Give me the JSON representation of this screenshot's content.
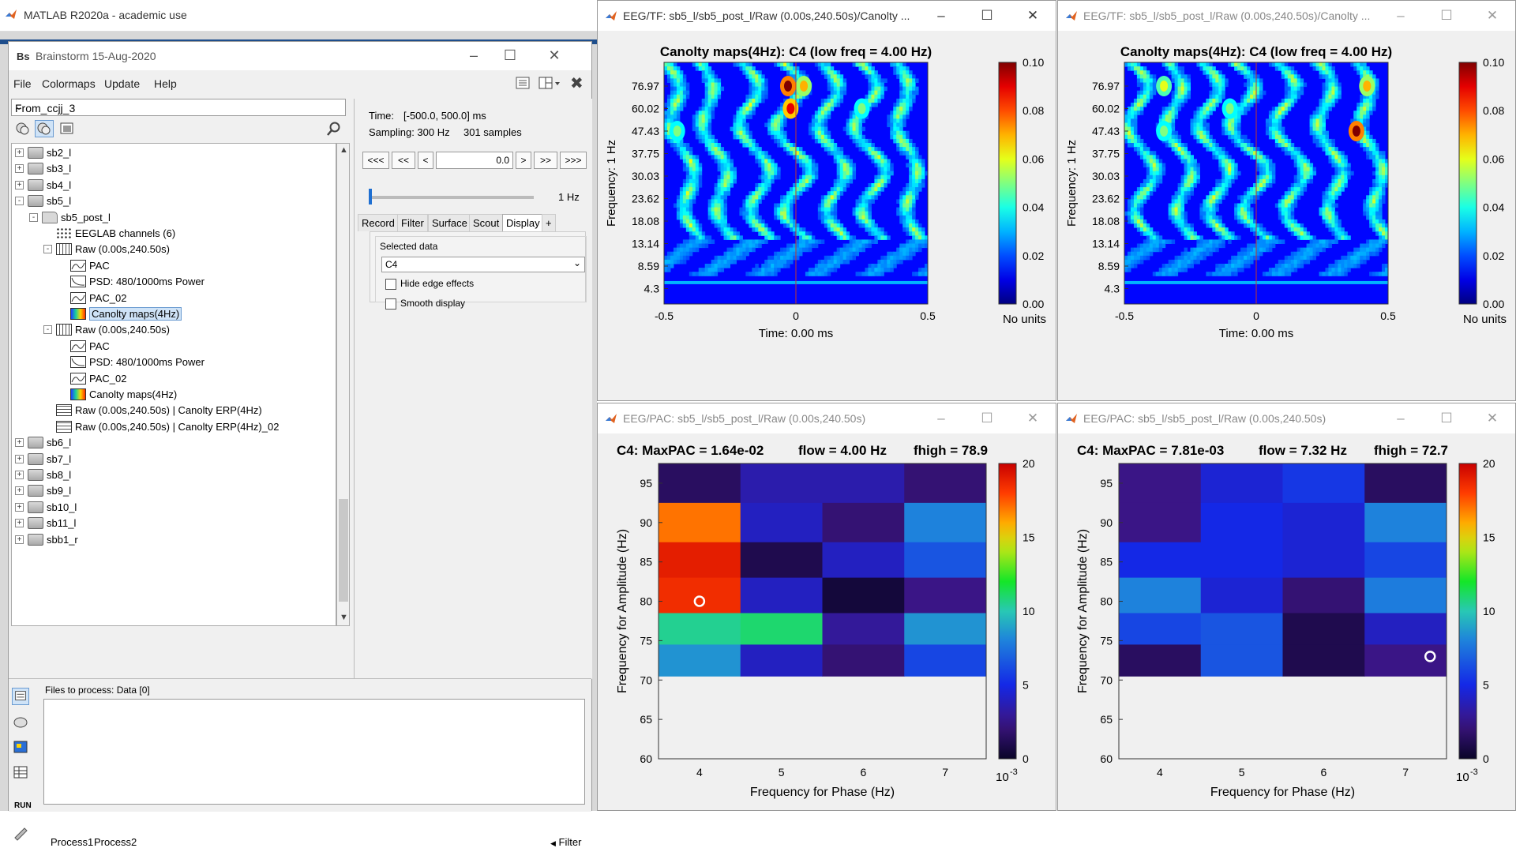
{
  "matlab": {
    "title": "MATLAB R2020a - academic use"
  },
  "brainstorm": {
    "title": "Brainstorm 15-Aug-2020",
    "menu": [
      "File",
      "Colormaps",
      "Update",
      "Help"
    ],
    "protocol": "From_ccjj_3",
    "tree": [
      {
        "label": "sb2_l",
        "indent": 0,
        "icon": "subject",
        "exp": "+"
      },
      {
        "label": "sb3_l",
        "indent": 0,
        "icon": "subject",
        "exp": "+"
      },
      {
        "label": "sb4_l",
        "indent": 0,
        "icon": "subject",
        "exp": "+"
      },
      {
        "label": "sb5_l",
        "indent": 0,
        "icon": "subject",
        "exp": "-"
      },
      {
        "label": "sb5_post_l",
        "indent": 1,
        "icon": "folder",
        "exp": "-"
      },
      {
        "label": "EEGLAB channels (6)",
        "indent": 2,
        "icon": "channels",
        "exp": ""
      },
      {
        "label": "Raw (0.00s,240.50s)",
        "indent": 2,
        "icon": "raw",
        "exp": "-"
      },
      {
        "label": "PAC",
        "indent": 3,
        "icon": "pac",
        "exp": ""
      },
      {
        "label": "PSD: 480/1000ms Power",
        "indent": 3,
        "icon": "psd",
        "exp": ""
      },
      {
        "label": "PAC_02",
        "indent": 3,
        "icon": "pac",
        "exp": ""
      },
      {
        "label": "Canolty maps(4Hz)",
        "indent": 3,
        "icon": "canolty",
        "exp": "",
        "selected": true
      },
      {
        "label": "Raw (0.00s,240.50s)",
        "indent": 2,
        "icon": "raw",
        "exp": "-"
      },
      {
        "label": "PAC",
        "indent": 3,
        "icon": "pac",
        "exp": ""
      },
      {
        "label": "PSD: 480/1000ms Power",
        "indent": 3,
        "icon": "psd",
        "exp": ""
      },
      {
        "label": "PAC_02",
        "indent": 3,
        "icon": "pac",
        "exp": ""
      },
      {
        "label": "Canolty maps(4Hz)",
        "indent": 3,
        "icon": "canolty",
        "exp": ""
      },
      {
        "label": "Raw (0.00s,240.50s) | Canolty ERP(4Hz)",
        "indent": 2,
        "icon": "table",
        "exp": ""
      },
      {
        "label": "Raw (0.00s,240.50s) | Canolty ERP(4Hz)_02",
        "indent": 2,
        "icon": "table",
        "exp": ""
      },
      {
        "label": "sb6_l",
        "indent": 0,
        "icon": "subject",
        "exp": "+"
      },
      {
        "label": "sb7_l",
        "indent": 0,
        "icon": "subject",
        "exp": "+"
      },
      {
        "label": "sb8_l",
        "indent": 0,
        "icon": "subject",
        "exp": "+"
      },
      {
        "label": "sb9_l",
        "indent": 0,
        "icon": "subject",
        "exp": "+"
      },
      {
        "label": "sb10_l",
        "indent": 0,
        "icon": "subject",
        "exp": "+"
      },
      {
        "label": "sb11_l",
        "indent": 0,
        "icon": "subject",
        "exp": "+"
      },
      {
        "label": "sbb1_r",
        "indent": 0,
        "icon": "subject",
        "exp": "+"
      }
    ],
    "panel": {
      "time_label": "Time:",
      "time_value": "[-500.0, 500.0] ms",
      "sampling_label": "Sampling: 300 Hz",
      "samples": "301 samples",
      "nav_buttons": [
        "<<<",
        "<<",
        "<",
        ">",
        ">>",
        ">>>"
      ],
      "time_field": "0.0",
      "freq_label": "1 Hz",
      "tabs": [
        "Record",
        "Filter",
        "Surface",
        "Scout",
        "Display",
        "+"
      ],
      "active_tab": "Display",
      "selected_data_label": "Selected data",
      "channel": "C4",
      "hide_edge": "Hide edge effects",
      "smooth": "Smooth display"
    },
    "process": {
      "files_label": "Files to process: Data [0]",
      "run_label": "RUN",
      "tabs": [
        "Process1",
        "Process2"
      ],
      "filter_label": "Filter"
    }
  },
  "figures": {
    "tf1": {
      "title": "EEG/TF: sb5_l/sb5_post_l/Raw (0.00s,240.50s)/Canolty ...",
      "plot_title": "Canolty maps(4Hz): C4   (low freq = 4.00 Hz)",
      "xlabel": "Time: 0.00 ms",
      "ylabel": "Frequency: 1 Hz",
      "yticks": [
        "76.97",
        "60.02",
        "47.43",
        "37.75",
        "30.03",
        "23.62",
        "18.08",
        "13.14",
        "8.59",
        "4.3"
      ],
      "xticks": [
        "-0.5",
        "0",
        "0.5"
      ],
      "cbar_ticks": [
        "0.10",
        "0.08",
        "0.06",
        "0.04",
        "0.02",
        "0.00"
      ],
      "cbar_unit": "No units",
      "active": true
    },
    "tf2": {
      "title": "EEG/TF: sb5_l/sb5_post_l/Raw (0.00s,240.50s)/Canolty ...",
      "plot_title": "Canolty maps(4Hz): C4   (low freq = 4.00 Hz)",
      "xlabel": "Time: 0.00 ms",
      "ylabel": "Frequency: 1 Hz",
      "yticks": [
        "76.97",
        "60.02",
        "47.43",
        "37.75",
        "30.03",
        "23.62",
        "18.08",
        "13.14",
        "8.59",
        "4.3"
      ],
      "xticks": [
        "-0.5",
        "0",
        "0.5"
      ],
      "cbar_ticks": [
        "0.10",
        "0.08",
        "0.06",
        "0.04",
        "0.02",
        "0.00"
      ],
      "cbar_unit": "No units",
      "active": false
    },
    "pac1": {
      "title": "EEG/PAC: sb5_l/sb5_post_l/Raw (0.00s,240.50s)",
      "plot_title_parts": [
        "C4: MaxPAC = 1.64e-02",
        "flow = 4.00 Hz",
        "fhigh = 78.9"
      ],
      "xlabel": "Frequency for Phase (Hz)",
      "ylabel": "Frequency for Amplitude (Hz)",
      "xticks": [
        "4",
        "5",
        "6",
        "7"
      ],
      "yticks": [
        "95",
        "90",
        "85",
        "80",
        "75",
        "70",
        "65",
        "60"
      ],
      "cbar_ticks": [
        "20",
        "15",
        "10",
        "5",
        "0"
      ],
      "cbar_exp": "10",
      "cbar_exp_power": "-3",
      "active": false
    },
    "pac2": {
      "title": "EEG/PAC: sb5_l/sb5_post_l/Raw (0.00s,240.50s)",
      "plot_title_parts": [
        "C4: MaxPAC = 7.81e-03",
        "flow = 7.32 Hz",
        "fhigh = 72.7"
      ],
      "xlabel": "Frequency for Phase (Hz)",
      "ylabel": "Frequency for Amplitude (Hz)",
      "xticks": [
        "4",
        "5",
        "6",
        "7"
      ],
      "yticks": [
        "95",
        "90",
        "85",
        "80",
        "75",
        "70",
        "65",
        "60"
      ],
      "cbar_ticks": [
        "20",
        "15",
        "10",
        "5",
        "0"
      ],
      "cbar_exp": "10",
      "cbar_exp_power": "-3",
      "active": false
    }
  },
  "chart_data": [
    {
      "type": "heatmap",
      "title": "Canolty maps(4Hz): C4   (low freq = 4.00 Hz)",
      "xlabel": "Time: 0.00 ms",
      "ylabel": "Frequency: 1 Hz",
      "xlim": [
        -0.5,
        0.5
      ],
      "clim": [
        0,
        0.1
      ],
      "cbar_label": "No units",
      "hotspots": [
        {
          "x": -0.03,
          "y": 76.97,
          "value": 0.1
        },
        {
          "x": -0.02,
          "y": 60.02,
          "value": 0.09
        },
        {
          "x": 0.03,
          "y": 76.97,
          "value": 0.07
        },
        {
          "x": -0.45,
          "y": 47.43,
          "value": 0.05
        },
        {
          "x": 0.25,
          "y": 60.02,
          "value": 0.05
        }
      ]
    },
    {
      "type": "heatmap",
      "title": "Canolty maps(4Hz): C4   (low freq = 4.00 Hz)",
      "xlabel": "Time: 0.00 ms",
      "ylabel": "Frequency: 1 Hz",
      "xlim": [
        -0.5,
        0.5
      ],
      "clim": [
        0,
        0.1
      ],
      "cbar_label": "No units",
      "hotspots": [
        {
          "x": 0.38,
          "y": 47.43,
          "value": 0.1
        },
        {
          "x": 0.42,
          "y": 76.97,
          "value": 0.07
        },
        {
          "x": -0.35,
          "y": 76.97,
          "value": 0.06
        },
        {
          "x": -0.35,
          "y": 47.43,
          "value": 0.05
        },
        {
          "x": -0.1,
          "y": 60.02,
          "value": 0.05
        }
      ]
    },
    {
      "type": "heatmap",
      "title": "C4: MaxPAC = 1.64e-02    flow = 4.00 Hz    fhigh = 78.9",
      "xlabel": "Frequency for Phase (Hz)",
      "ylabel": "Frequency for Amplitude (Hz)",
      "x": [
        4,
        5,
        6,
        7
      ],
      "y": [
        95,
        90,
        85,
        80,
        75,
        70,
        65
      ],
      "values_e3": [
        [
          1.5,
          3.5,
          3.5,
          2.0
        ],
        [
          17.0,
          4.0,
          2.0,
          8.0
        ],
        [
          19.0,
          1.0,
          4.0,
          6.5
        ],
        [
          18.5,
          4.0,
          0.5,
          2.5
        ],
        [
          10.5,
          11.0,
          3.0,
          8.5
        ],
        [
          8.5,
          4.0,
          2.0,
          6.0
        ]
      ],
      "clim": [
        0,
        20
      ],
      "max_marker": {
        "x": 4,
        "y": 80
      }
    },
    {
      "type": "heatmap",
      "title": "C4: MaxPAC = 7.81e-03    flow = 7.32 Hz    fhigh = 72.7",
      "xlabel": "Frequency for Phase (Hz)",
      "ylabel": "Frequency for Amplitude (Hz)",
      "x": [
        4,
        5,
        6,
        7
      ],
      "y": [
        95,
        90,
        85,
        80,
        75,
        70,
        65
      ],
      "values_e3": [
        [
          2.5,
          4.5,
          5.5,
          1.5
        ],
        [
          2.5,
          5.0,
          4.5,
          8.0
        ],
        [
          5.0,
          5.0,
          4.5,
          6.0
        ],
        [
          8.0,
          4.5,
          2.0,
          7.81
        ],
        [
          6.0,
          6.5,
          1.0,
          4.0
        ],
        [
          1.5,
          6.5,
          1.0,
          2.5
        ]
      ],
      "clim": [
        0,
        20
      ],
      "max_marker": {
        "x": 7.3,
        "y": 73
      }
    }
  ]
}
